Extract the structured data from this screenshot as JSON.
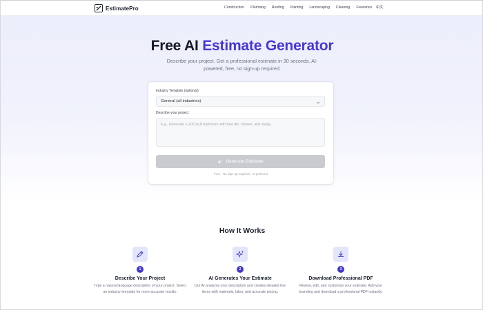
{
  "brand": {
    "name": "EstimatePro",
    "icon": "calculator-pen-icon"
  },
  "nav": {
    "links": [
      "Construction",
      "Plumbing",
      "Roofing",
      "Painting",
      "Landscaping",
      "Cleaning",
      "Freelance"
    ],
    "language": "中文"
  },
  "hero": {
    "title_plain": "Free AI ",
    "title_accent": "Estimate Generator",
    "subtitle": "Describe your project. Get a professional estimate in 30 seconds. AI-powered, free, no sign-up required."
  },
  "form": {
    "template_label": "Industry Template (optional)",
    "template_value": "General (all industries)",
    "description_label": "Describe your project",
    "description_placeholder": "E.g., Renovate a 200 sq ft bathroom with new tile, shower, and vanity...",
    "generate_label": "Generate Estimate",
    "footnote": "Free · No sign-up required · AI-powered"
  },
  "how_it_works": {
    "title": "How It Works",
    "steps": [
      {
        "num": "1",
        "title": "Describe Your Project",
        "desc": "Type a natural language description of your project. Select an industry template for more accurate results.",
        "icon": "pen-tool-icon"
      },
      {
        "num": "2",
        "title": "AI Generates Your Estimate",
        "desc": "Our AI analyzes your description and creates detailed line items with materials, labor, and accurate pricing.",
        "icon": "sparkles-icon"
      },
      {
        "num": "3",
        "title": "Download Professional PDF",
        "desc": "Review, edit, and customize your estimate. Add your branding and download a professional PDF instantly.",
        "icon": "download-icon"
      }
    ]
  },
  "colors": {
    "accent": "#4538d6",
    "step_badge": "#4338ca",
    "button_disabled": "#c9cbcf"
  }
}
